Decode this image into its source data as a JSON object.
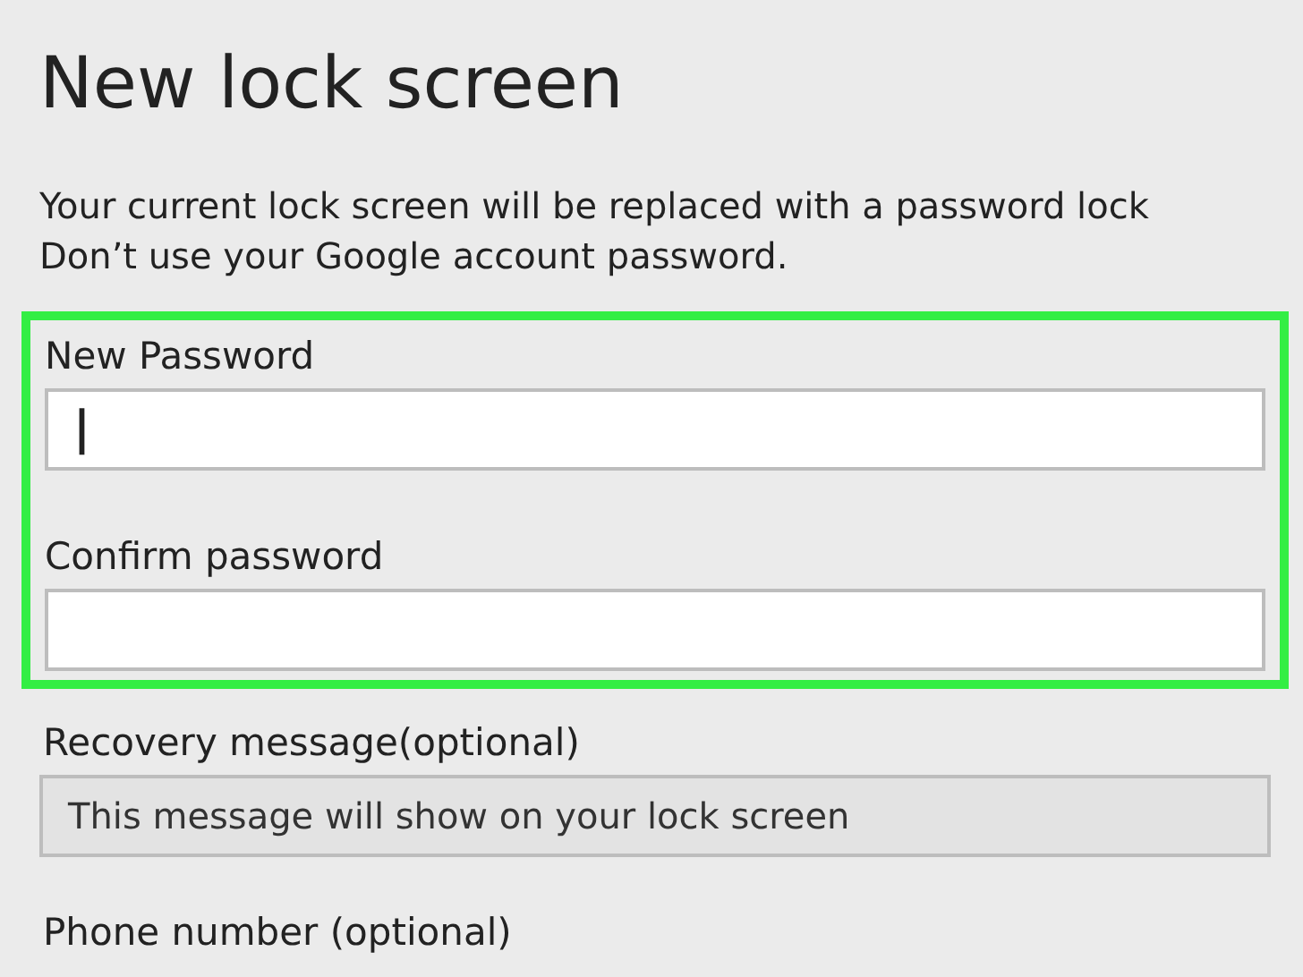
{
  "title": "New lock screen",
  "description_lines": [
    "Your current lock screen will be replaced with a password lock",
    "Don’t use your Google account password."
  ],
  "highlighted_group": {
    "highlighted": true,
    "fields": [
      {
        "label": "New Password",
        "cursor": "|"
      },
      {
        "label": "Confirm password"
      }
    ]
  },
  "optional_fields": [
    {
      "label": "Recovery message(optional)",
      "placeholder": "This message will show on your lock screen"
    },
    {
      "label": "Phone number (optional)"
    }
  ]
}
